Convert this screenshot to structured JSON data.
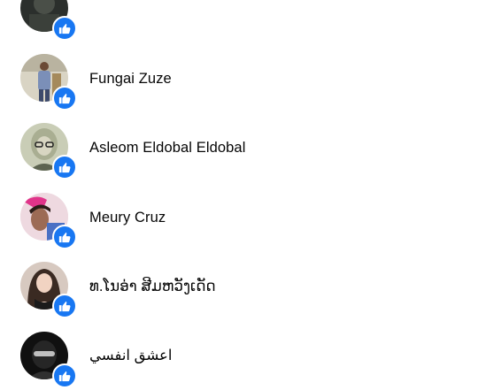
{
  "people": [
    {
      "name": "",
      "avatar": "dark-portrait"
    },
    {
      "name": "Fungai Zuze",
      "avatar": "man-standing"
    },
    {
      "name": "Asleom Eldobal Eldobal",
      "avatar": "banknote-portrait"
    },
    {
      "name": "Meury Cruz",
      "avatar": "selfie-pink"
    },
    {
      "name": "ທ.ໂນອ່າ ສີມຫວັງເດັດ",
      "avatar": "woman-portrait"
    },
    {
      "name": "اعشق انفسي",
      "avatar": "masked-figure"
    }
  ],
  "badge_icon": "thumbs-up-icon",
  "colors": {
    "badge": "#1877f2",
    "text": "#050505"
  }
}
